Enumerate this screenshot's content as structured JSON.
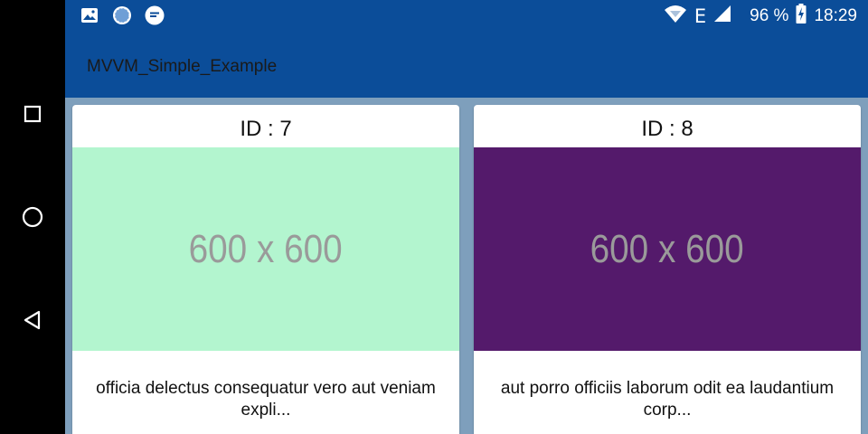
{
  "status_bar": {
    "battery_percent": "96 %",
    "time": "18:29",
    "network_type": "E",
    "left_icons": [
      "image-icon",
      "globe-icon",
      "message-icon"
    ],
    "right_icons": [
      "wifi-icon",
      "signal-icon",
      "battery-charging-icon"
    ]
  },
  "app_bar": {
    "title": "MVVM_Simple_Example",
    "background": "#0b4d99"
  },
  "navigation_bar": {
    "buttons": [
      "recents-icon",
      "home-icon",
      "back-icon"
    ]
  },
  "items": [
    {
      "id_label": "ID : 7",
      "image_text": "600 x 600",
      "image_color": "#b3f5cf",
      "description": "officia delectus consequatur vero aut veniam expli..."
    },
    {
      "id_label": "ID : 8",
      "image_text": "600 x 600",
      "image_color": "#541a6b",
      "description": "aut porro officiis laborum odit ea laudantium corp..."
    }
  ]
}
